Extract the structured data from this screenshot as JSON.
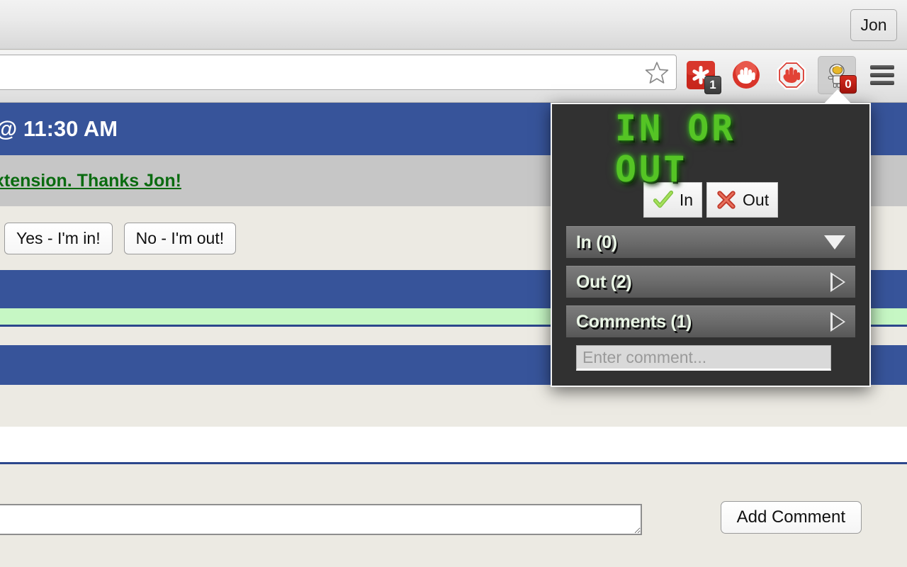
{
  "browser": {
    "profile_button_label": "Jon",
    "address_bar_value": "",
    "address_bar_placeholder": "",
    "star_icon": "bookmark-star-icon",
    "menu_icon": "hamburger-menu-icon",
    "toolbar_buttons": [
      {
        "name": "lastpass-extension-icon",
        "badge": "1",
        "badge_style": "dark"
      },
      {
        "name": "adblock-hand-icon",
        "badge": "",
        "badge_style": "none"
      },
      {
        "name": "adblock-plus-stopsign-icon",
        "badge": "",
        "badge_style": "none"
      },
      {
        "name": "in-or-out-extension-icon",
        "badge": "0",
        "badge_style": "red"
      }
    ]
  },
  "page": {
    "event_title": "@ 11:30 AM",
    "thanks_message": "xtension. Thanks Jon!",
    "vote_yes_label": "Yes - I'm in!",
    "vote_no_label": "No - I'm out!",
    "comment_textarea_value": "",
    "add_comment_label": "Add Comment"
  },
  "popup": {
    "logo_text": "IN OR OUT",
    "in_button_label": "In",
    "out_button_label": "Out",
    "check_icon": "green-check-icon",
    "cross_icon": "red-x-icon",
    "sections": [
      {
        "label": "In (0)",
        "state": "expanded",
        "arrow": "chevron-down-icon"
      },
      {
        "label": "Out (2)",
        "state": "collapsed",
        "arrow": "chevron-right-icon"
      },
      {
        "label": "Comments (1)",
        "state": "collapsed",
        "arrow": "chevron-right-icon"
      }
    ],
    "comment_placeholder": "Enter comment...",
    "comment_value": ""
  },
  "colors": {
    "popup_bg": "#313131",
    "section_bar": "#6d6d6d",
    "led_green": "#55c425",
    "page_blue": "#37549a",
    "page_beige": "#eceae3",
    "link_green": "#0a6b10",
    "highlight_green": "#c6f7c4",
    "badge_red": "#c2180f"
  }
}
